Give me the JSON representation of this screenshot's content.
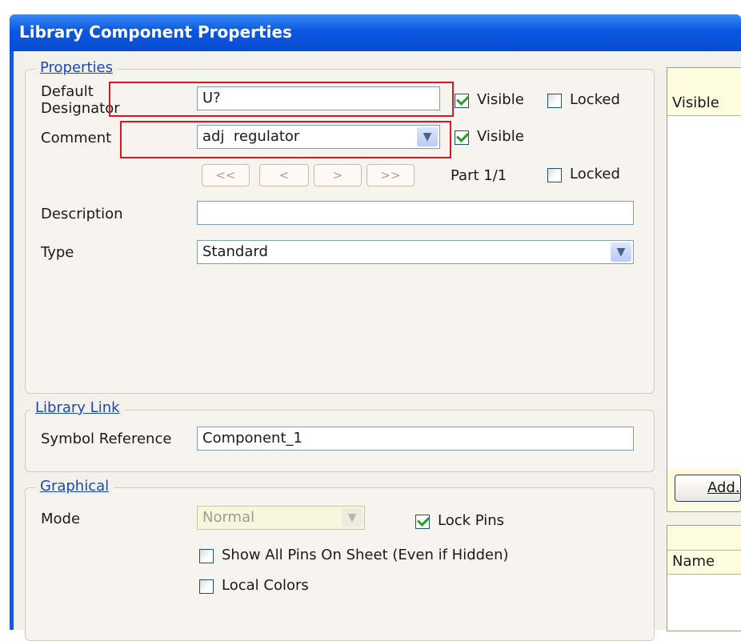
{
  "window": {
    "title": "Library Component Properties"
  },
  "properties": {
    "legend": "Properties",
    "designator_label": "Default\nDesignator",
    "designator_value": "U?",
    "designator_visible_label": "Visible",
    "designator_visible_checked": true,
    "designator_locked_label": "Locked",
    "designator_locked_checked": false,
    "comment_label": "Comment",
    "comment_value": "adj  regulator",
    "comment_visible_label": "Visible",
    "comment_visible_checked": true,
    "nav_first": "<<",
    "nav_prev": "<",
    "nav_next": ">",
    "nav_last": ">>",
    "part_label": "Part 1/1",
    "part_locked_label": "Locked",
    "part_locked_checked": false,
    "description_label": "Description",
    "description_value": "",
    "type_label": "Type",
    "type_value": "Standard"
  },
  "library_link": {
    "legend": "Library Link",
    "symbol_ref_label": "Symbol Reference",
    "symbol_ref_value": "Component_1"
  },
  "graphical": {
    "legend": "Graphical",
    "mode_label": "Mode",
    "mode_value": "Normal",
    "lock_pins_label": "Lock Pins",
    "lock_pins_checked": true,
    "show_all_pins_label": "Show All Pins On Sheet (Even if Hidden)",
    "show_all_pins_checked": false,
    "local_colors_label": "Local Colors",
    "local_colors_checked": false
  },
  "right_panel": {
    "params_col_visible": "Visible",
    "add_button": "Add.",
    "models_col_name": "Name"
  },
  "colors": {
    "title_bar": "#0a58e0",
    "highlight_box": "#e0141e",
    "legend_text": "#1f47b5"
  }
}
